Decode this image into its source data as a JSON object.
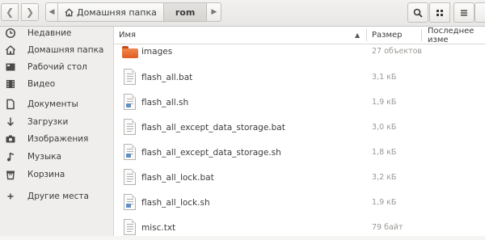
{
  "header": {
    "back_icon": "chevron-left-icon",
    "forward_icon": "chevron-right-icon",
    "path": {
      "crumbs": [
        {
          "label": "Домашняя папка",
          "icon": "home-icon"
        },
        {
          "label": "rom",
          "active": true
        }
      ]
    },
    "tools": {
      "search_icon": "search-icon",
      "view_icon": "grid-view-icon",
      "menu_icon": "hamburger-menu-icon"
    }
  },
  "sidebar": {
    "items": [
      {
        "label": "Недавние",
        "icon": "clock-icon"
      },
      {
        "label": "Домашняя папка",
        "icon": "home-icon"
      },
      {
        "label": "Рабочий стол",
        "icon": "desktop-folder-icon"
      },
      {
        "label": "Видео",
        "icon": "video-icon"
      },
      {
        "label": "Документы",
        "icon": "document-icon"
      },
      {
        "label": "Загрузки",
        "icon": "download-icon"
      },
      {
        "label": "Изображения",
        "icon": "camera-icon"
      },
      {
        "label": "Музыка",
        "icon": "music-icon"
      },
      {
        "label": "Корзина",
        "icon": "trash-icon"
      },
      {
        "label": "Другие места",
        "icon": "plus-icon"
      }
    ]
  },
  "columns": {
    "name": "Имя",
    "size": "Размер",
    "modified": "Последнее изме"
  },
  "files": [
    {
      "name": "images",
      "size": "27 объектов",
      "type": "folder"
    },
    {
      "name": "flash_all.bat",
      "size": "3,1 кБ",
      "type": "text"
    },
    {
      "name": "flash_all.sh",
      "size": "1,9 кБ",
      "type": "script"
    },
    {
      "name": "flash_all_except_data_storage.bat",
      "size": "3,0 кБ",
      "type": "text"
    },
    {
      "name": "flash_all_except_data_storage.sh",
      "size": "1,8 кБ",
      "type": "script"
    },
    {
      "name": "flash_all_lock.bat",
      "size": "3,2 кБ",
      "type": "text"
    },
    {
      "name": "flash_all_lock.sh",
      "size": "1,9 кБ",
      "type": "script"
    },
    {
      "name": "misc.txt",
      "size": "79 байт",
      "type": "text"
    }
  ],
  "colors": {
    "folder": "#e8642a",
    "script_badge": "#5b8fc7"
  }
}
